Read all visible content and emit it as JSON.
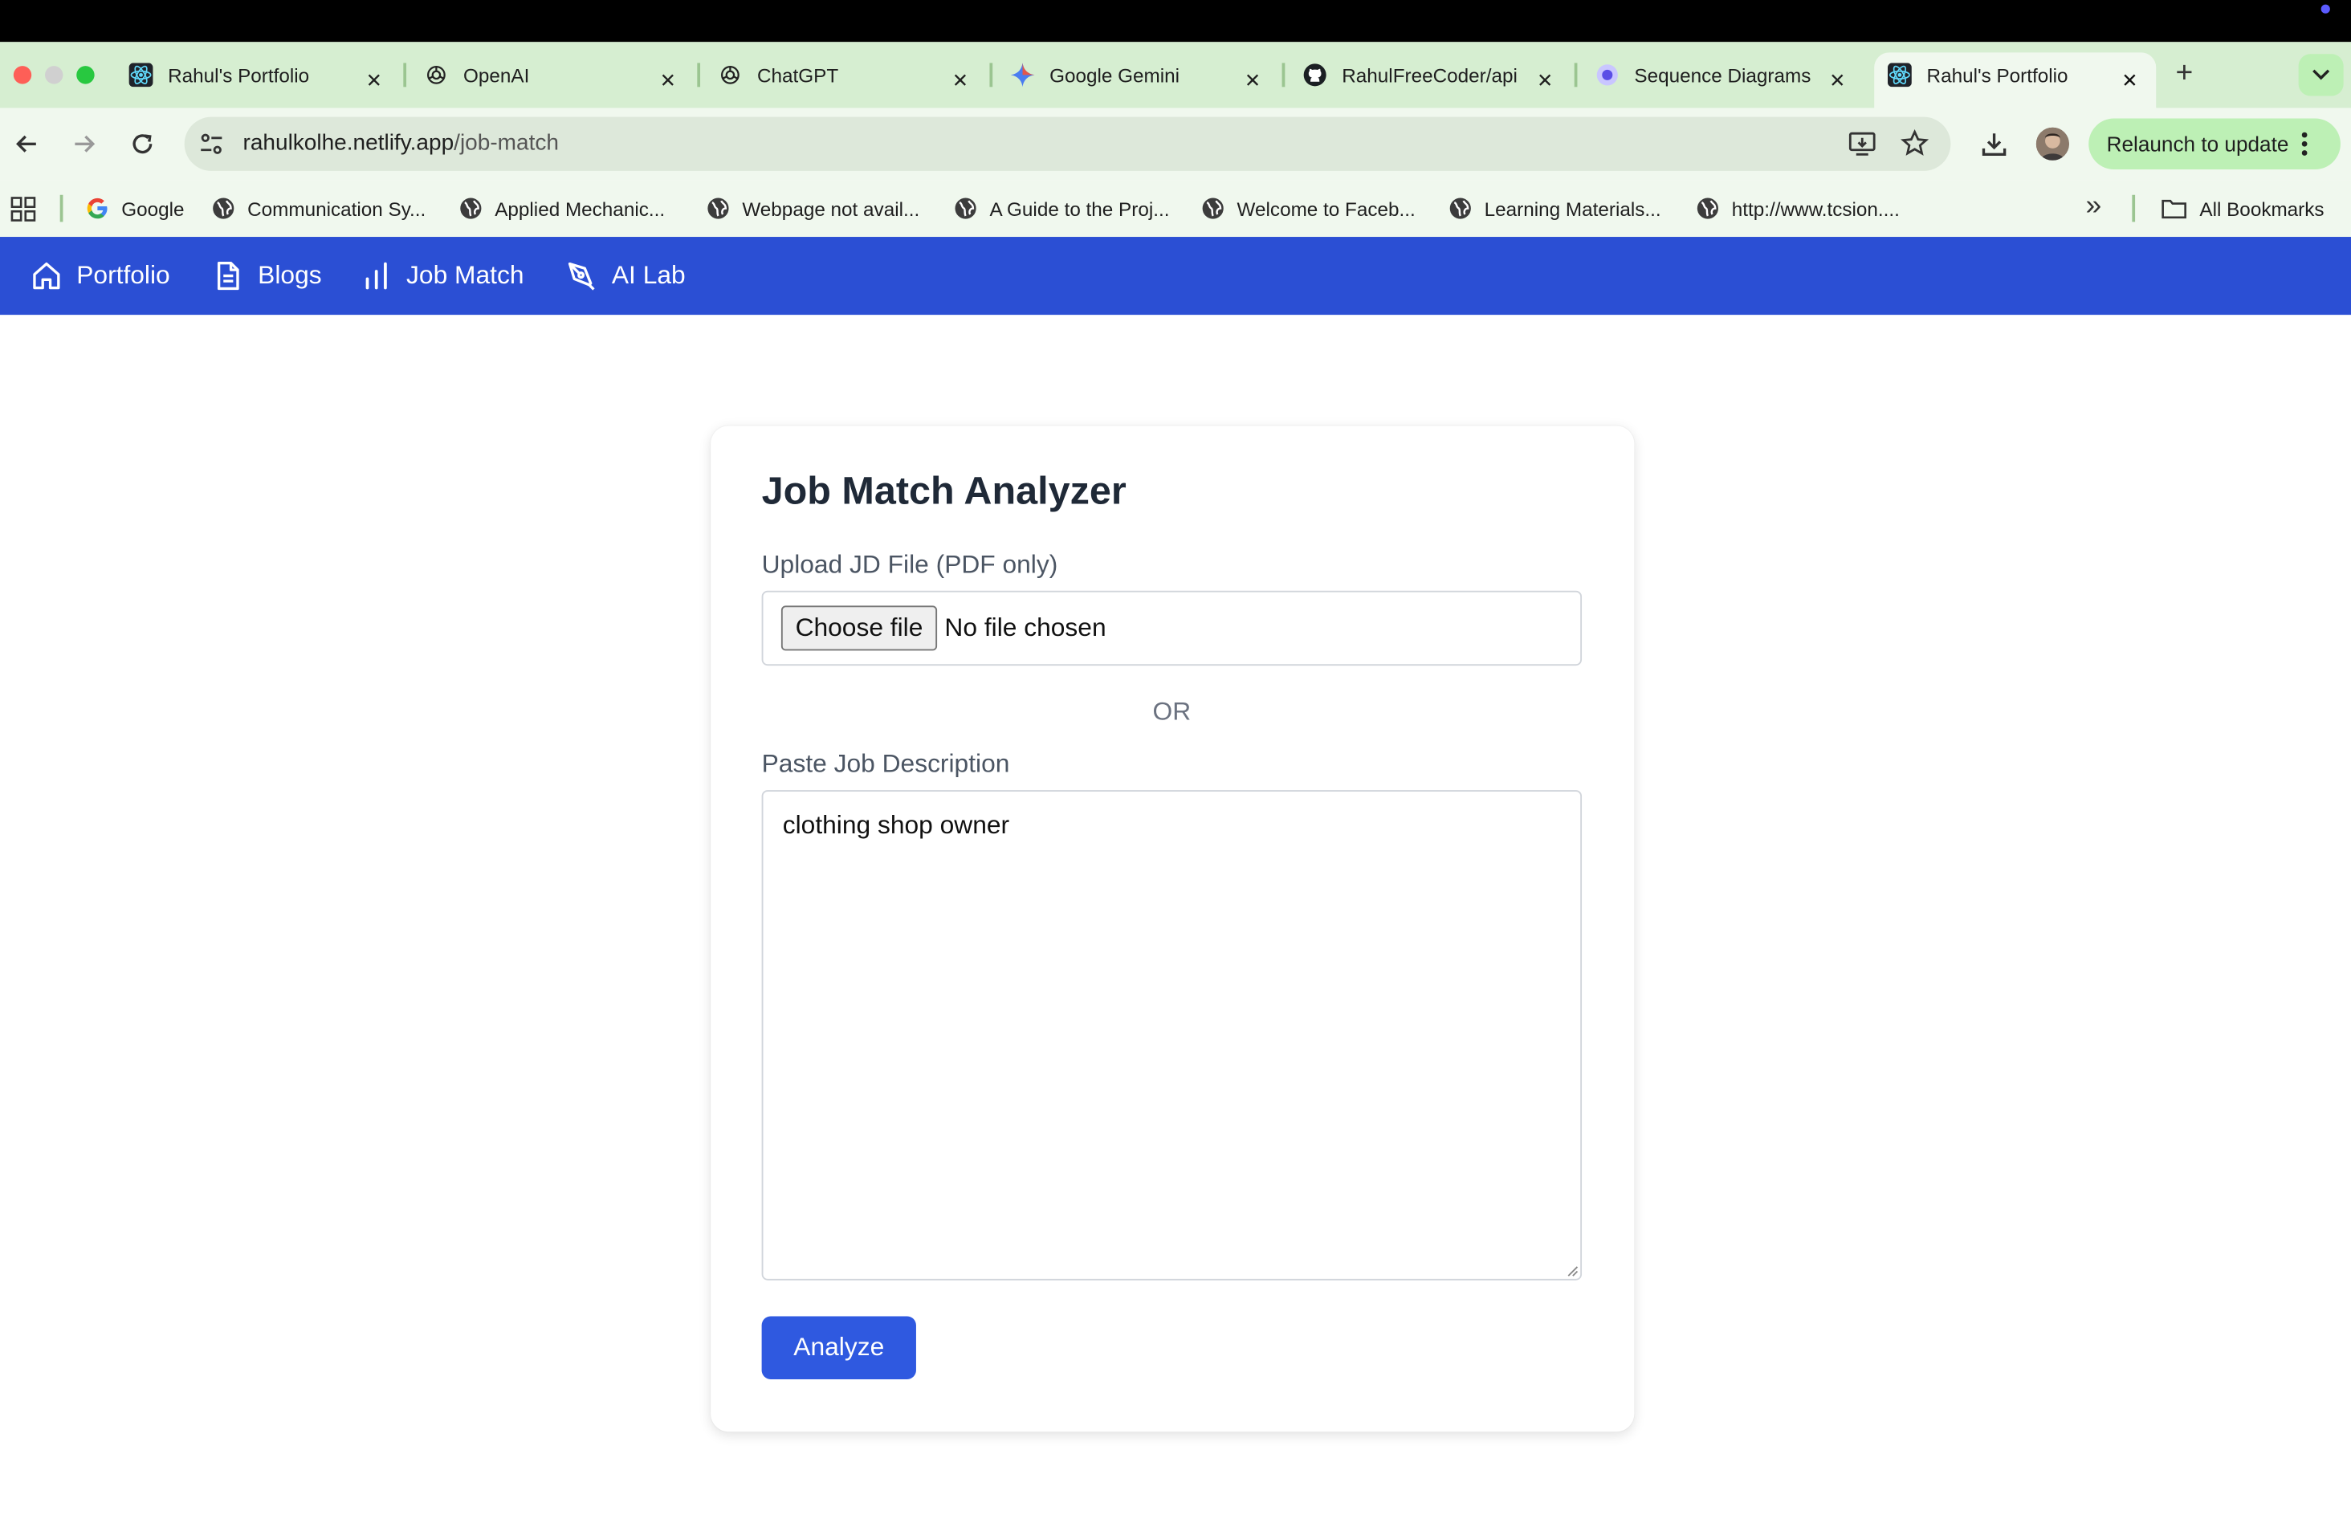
{
  "browser": {
    "tabs": [
      {
        "title": "Rahul's Portfolio",
        "icon": "react-icon"
      },
      {
        "title": "OpenAI",
        "icon": "openai-icon"
      },
      {
        "title": "ChatGPT",
        "icon": "openai-icon"
      },
      {
        "title": "Google Gemini",
        "icon": "gemini-icon"
      },
      {
        "title": "RahulFreeCoder/api",
        "icon": "github-icon"
      },
      {
        "title": "Sequence Diagrams",
        "icon": "diagram-icon"
      },
      {
        "title": "Rahul's Portfolio",
        "icon": "react-icon",
        "active": true
      }
    ],
    "new_tab": "+",
    "address": {
      "host": "rahulkolhe.netlify.app",
      "path": "/job-match"
    },
    "relaunch_label": "Relaunch to update",
    "bookmarks": [
      {
        "label": "Google",
        "icon": "google-icon"
      },
      {
        "label": "Communication Sy...",
        "icon": "globe-icon"
      },
      {
        "label": "Applied Mechanic...",
        "icon": "globe-icon"
      },
      {
        "label": "Webpage not avail...",
        "icon": "globe-icon"
      },
      {
        "label": "A Guide to the Proj...",
        "icon": "globe-icon"
      },
      {
        "label": "Welcome to Faceb...",
        "icon": "globe-icon"
      },
      {
        "label": "Learning Materials...",
        "icon": "globe-icon"
      },
      {
        "label": "http://www.tcsion....",
        "icon": "globe-icon"
      }
    ],
    "overflow": "»",
    "all_bookmarks": "All Bookmarks"
  },
  "nav": {
    "items": [
      {
        "label": "Portfolio",
        "icon": "home-icon"
      },
      {
        "label": "Blogs",
        "icon": "document-icon"
      },
      {
        "label": "Job Match",
        "icon": "bar-chart-icon"
      },
      {
        "label": "AI Lab",
        "icon": "pen-tool-icon"
      }
    ],
    "color": "#2b4fd4"
  },
  "form": {
    "title": "Job Match Analyzer",
    "upload_label": "Upload JD File (PDF only)",
    "choose_file": "Choose file",
    "no_file": "No file chosen",
    "or": "OR",
    "paste_label": "Paste Job Description",
    "description_value": "clothing shop owner",
    "analyze": "Analyze",
    "accent": "#2f59e0"
  }
}
